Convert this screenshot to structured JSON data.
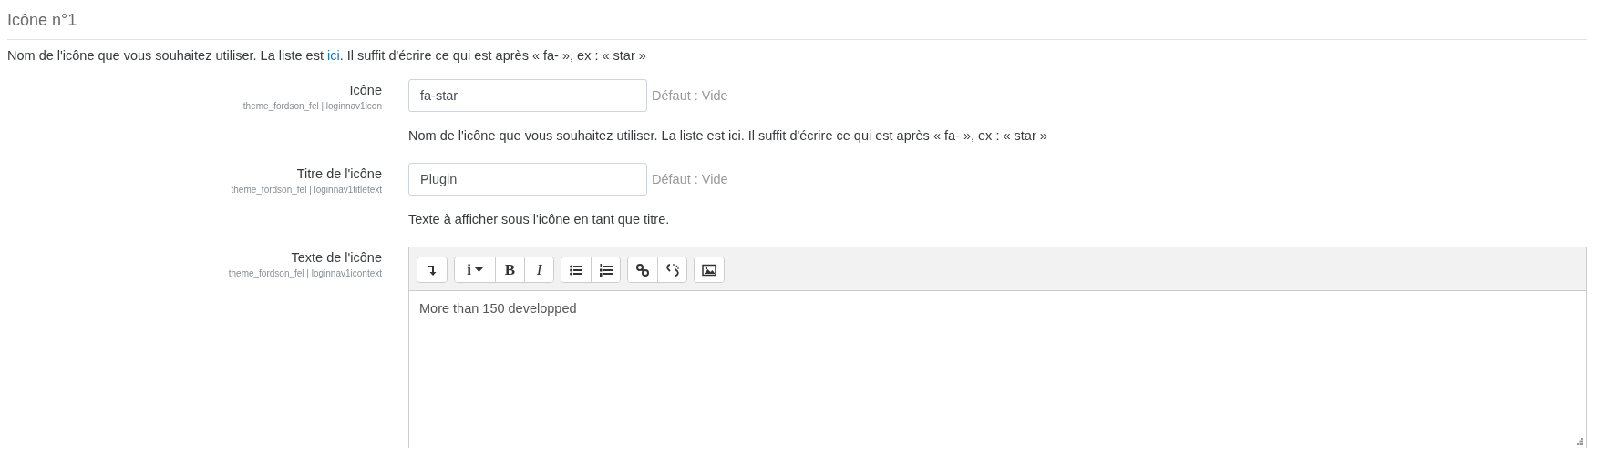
{
  "section": {
    "title": "Icône n°1",
    "description": {
      "before": "Nom de l'icône que vous souhaitez utiliser. La liste est ",
      "link": "ici",
      "after": ". Il suffit d'écrire ce qui est après « fa- », ex : « star »"
    }
  },
  "settings": [
    {
      "kind": "text",
      "label": "Icône",
      "id": "theme_fordson_fel | loginnav1icon",
      "value": "fa-star",
      "default": "Défaut : Vide",
      "help": "Nom de l'icône que vous souhaitez utiliser. La liste est ici. Il suffit d'écrire ce qui est après « fa- », ex : « star »"
    },
    {
      "kind": "text",
      "label": "Titre de l'icône",
      "id": "theme_fordson_fel | loginnav1titletext",
      "value": "Plugin",
      "default": "Défaut : Vide",
      "help": "Texte à afficher sous l'icône en tant que titre."
    },
    {
      "kind": "editor",
      "label": "Texte de l'icône",
      "id": "theme_fordson_fel | loginnav1icontext",
      "value": "More than 150 developped",
      "toolbar": [
        [
          {
            "kind": "collapse"
          }
        ],
        [
          {
            "kind": "info",
            "label": "i"
          },
          {
            "kind": "bold",
            "label": "B"
          },
          {
            "kind": "italic",
            "label": "I"
          }
        ],
        [
          {
            "kind": "bullets"
          },
          {
            "kind": "numbers"
          }
        ],
        [
          {
            "kind": "link"
          },
          {
            "kind": "unlink"
          }
        ],
        [
          {
            "kind": "image"
          }
        ]
      ]
    }
  ]
}
